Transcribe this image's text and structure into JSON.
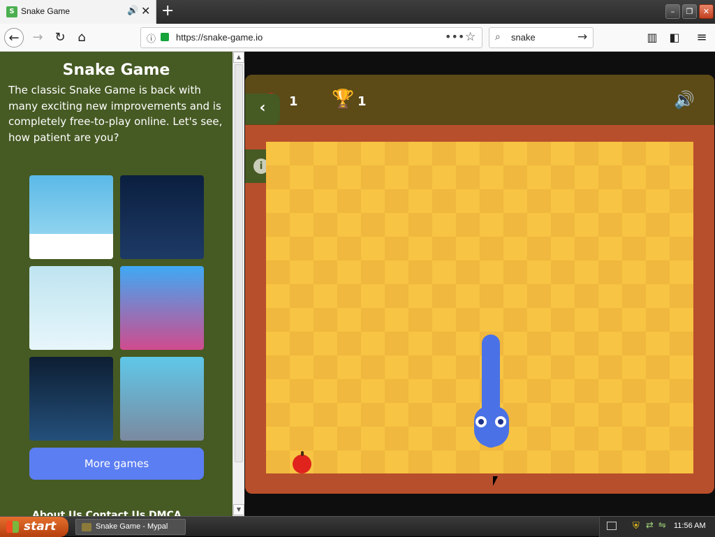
{
  "browser": {
    "tab_title": "Snake Game",
    "new_tab": "+",
    "url": "https://snake-game.io",
    "search_query": "snake"
  },
  "left_panel": {
    "title": "Snake Game",
    "description": "The classic Snake Game is back with many exciting new improvements and is completely free-to-play online. Let's see, how patient are you?",
    "more_games_label": "More games",
    "footer_links": "About Us   Contact Us   DMCA"
  },
  "game": {
    "apple_score": "1",
    "best_score": "1",
    "back_tab_icon": "‹",
    "info_icon": "i"
  },
  "taskbar": {
    "start_label": "start",
    "task_item": "Snake Game - Mypal",
    "clock": "11:56 AM"
  },
  "colors": {
    "panel_bg": "#465a23",
    "board_light": "#f7c443",
    "board_dark": "#f0b83e",
    "board_border": "#b84f2c",
    "snake": "#4a72e6",
    "apple": "#e0231d",
    "button_accent": "#5b7ef2"
  }
}
